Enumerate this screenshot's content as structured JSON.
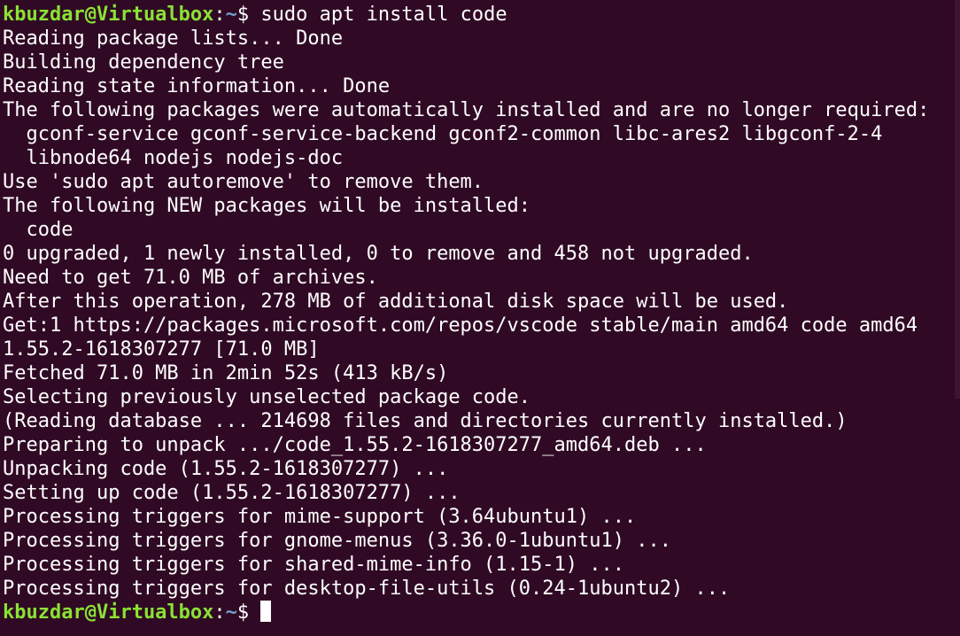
{
  "prompt": {
    "user_host": "kbuzdar@Virtualbox",
    "separator": ":",
    "path": "~",
    "symbol": "$ "
  },
  "command": "sudo apt install code",
  "output_lines": [
    "Reading package lists... Done",
    "Building dependency tree",
    "Reading state information... Done",
    "The following packages were automatically installed and are no longer required:",
    "  gconf-service gconf-service-backend gconf2-common libc-ares2 libgconf-2-4",
    "  libnode64 nodejs nodejs-doc",
    "Use 'sudo apt autoremove' to remove them.",
    "The following NEW packages will be installed:",
    "  code",
    "0 upgraded, 1 newly installed, 0 to remove and 458 not upgraded.",
    "Need to get 71.0 MB of archives.",
    "After this operation, 278 MB of additional disk space will be used.",
    "Get:1 https://packages.microsoft.com/repos/vscode stable/main amd64 code amd64",
    "1.55.2-1618307277 [71.0 MB]",
    "Fetched 71.0 MB in 2min 52s (413 kB/s)",
    "Selecting previously unselected package code.",
    "(Reading database ... 214698 files and directories currently installed.)",
    "Preparing to unpack .../code_1.55.2-1618307277_amd64.deb ...",
    "Unpacking code (1.55.2-1618307277) ...",
    "Setting up code (1.55.2-1618307277) ...",
    "Processing triggers for mime-support (3.64ubuntu1) ...",
    "Processing triggers for gnome-menus (3.36.0-1ubuntu1) ...",
    "Processing triggers for shared-mime-info (1.15-1) ...",
    "Processing triggers for desktop-file-utils (0.24-1ubuntu2) ..."
  ]
}
